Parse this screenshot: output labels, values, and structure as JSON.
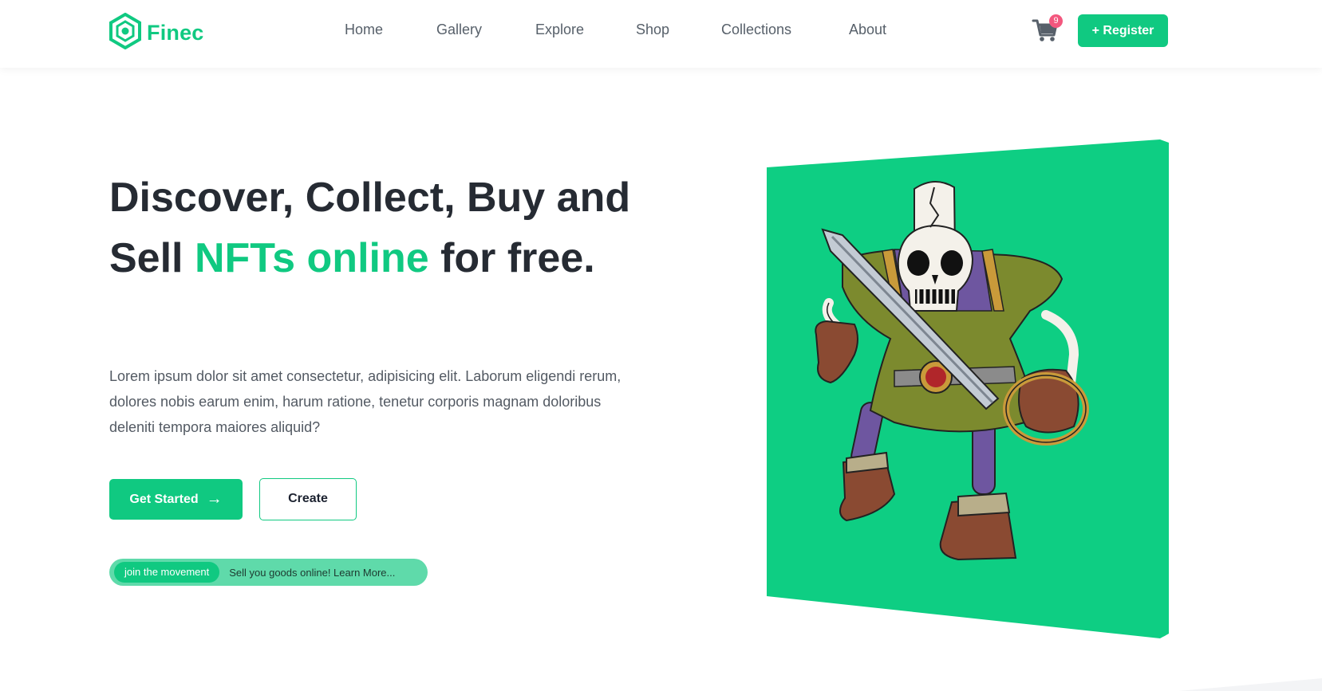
{
  "header": {
    "logo_text": "Finec",
    "nav": [
      "Home",
      "Gallery",
      "Explore",
      "Shop",
      "Collections",
      "About"
    ],
    "cart_count": "9",
    "register_label": "+ Register"
  },
  "hero": {
    "headline_part1": "Discover, Collect, Buy and Sell ",
    "headline_accent": "NFTs online",
    "headline_part2": " for free.",
    "description": "Lorem ipsum dolor sit amet consectetur, adipisicing elit. Laborum eligendi rerum, dolores nobis earum enim, harum ratione, tenetur corporis magnam doloribus deleniti tempora maiores aliquid?",
    "primary_label": "Get Started",
    "primary_arrow": "→",
    "secondary_label": "Create",
    "pill_tag": "join the movement",
    "pill_text": "Sell you goods online! Learn More..."
  },
  "icons": {
    "logo": "hexagon-logo-icon",
    "cart": "shopping-cart-icon",
    "artwork": "skeleton-warrior-nft-illustration"
  },
  "colors": {
    "accent": "#10c981",
    "badge": "#f3577e",
    "heading": "#262b33",
    "text": "#535a63",
    "pill_bg": "#5fdaaa"
  }
}
